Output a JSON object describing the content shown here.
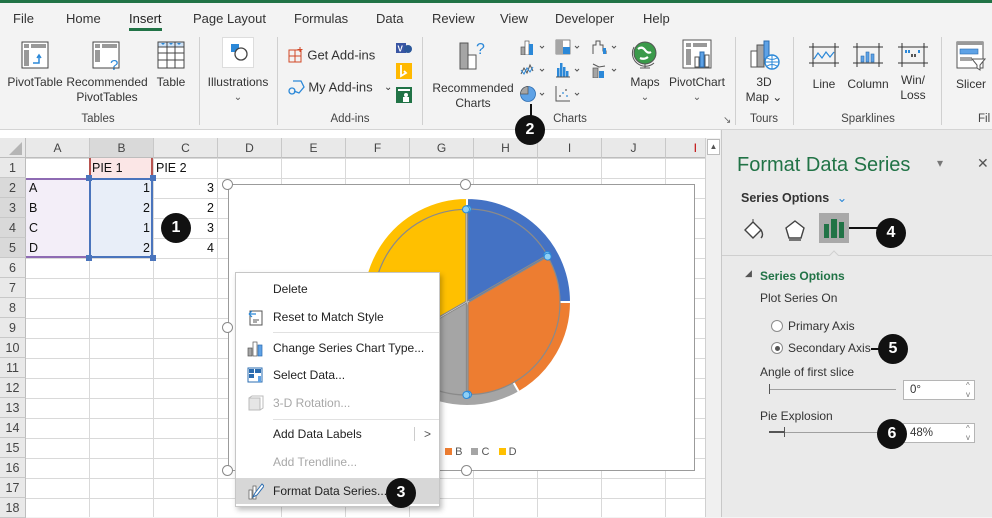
{
  "ribbon_tabs": [
    "File",
    "Home",
    "Insert",
    "Page Layout",
    "Formulas",
    "Data",
    "Review",
    "View",
    "Developer",
    "Help"
  ],
  "active_tab": "Insert",
  "ribbon": {
    "tables": {
      "label": "Tables",
      "pivottable": "PivotTable",
      "recommended_pivot_1": "Recommended",
      "recommended_pivot_2": "PivotTables",
      "table": "Table"
    },
    "illustrations": {
      "label": "Illustrations",
      "chevron": "⌄"
    },
    "addins": {
      "label": "Add-ins",
      "get": "Get Add-ins",
      "my": "My Add-ins",
      "chevron": "⌄"
    },
    "charts": {
      "label": "Charts",
      "recommended_1": "Recommended",
      "recommended_2": "Charts",
      "maps": "Maps",
      "pivotchart": "PivotChart",
      "chevron": "⌄",
      "launcher": "↘"
    },
    "tours": {
      "label": "Tours",
      "map_1": "3D",
      "map_2": "Map ⌄"
    },
    "sparklines": {
      "label": "Sparklines",
      "line": "Line",
      "column": "Column",
      "winloss_1": "Win/",
      "winloss_2": "Loss"
    },
    "filters": {
      "label": "Fil",
      "slicer": "Slicer"
    }
  },
  "sheet": {
    "columns": [
      "A",
      "B",
      "C",
      "D",
      "E",
      "F",
      "G",
      "H",
      "I",
      "J",
      "I"
    ],
    "rows": [
      "1",
      "2",
      "3",
      "4",
      "5",
      "6",
      "7",
      "8",
      "9",
      "10",
      "11",
      "12",
      "13",
      "14",
      "15",
      "16",
      "17",
      "18"
    ],
    "header": {
      "b1": "PIE 1",
      "c1": "PIE 2"
    },
    "data": [
      {
        "label": "A",
        "pie1": "1",
        "pie2": "3"
      },
      {
        "label": "B",
        "pie1": "2",
        "pie2": "2"
      },
      {
        "label": "C",
        "pie1": "1",
        "pie2": "3"
      },
      {
        "label": "D",
        "pie1": "2",
        "pie2": "4"
      }
    ]
  },
  "chart": {
    "type": "pie",
    "legend": [
      "A",
      "B",
      "C",
      "D"
    ],
    "colors": {
      "A": "#4472c4",
      "B": "#ed7d31",
      "C": "#a5a5a5",
      "D": "#ffc000"
    }
  },
  "context_menu": {
    "items": [
      {
        "label": "Delete",
        "icon": "none",
        "disabled": false
      },
      {
        "label": "Reset to Match Style",
        "icon": "reset-style-icon",
        "disabled": false
      },
      {
        "label": "Change Series Chart Type...",
        "icon": "chart-type-icon",
        "disabled": false
      },
      {
        "label": "Select Data...",
        "icon": "select-data-icon",
        "disabled": false
      },
      {
        "label": "3-D Rotation...",
        "icon": "3d-rotation-icon",
        "disabled": true
      },
      {
        "label": "Add Data Labels",
        "icon": "none",
        "disabled": false,
        "submenu": ">"
      },
      {
        "label": "Add Trendline...",
        "icon": "none",
        "disabled": true
      },
      {
        "label": "Format Data Series...",
        "icon": "format-series-icon",
        "disabled": false
      }
    ]
  },
  "format_pane": {
    "title": "Format Data Series",
    "dropdown": "▾",
    "close": "✕",
    "series_options_label": "Series Options",
    "section_title": "Series Options",
    "plot_series_on": "Plot Series On",
    "primary_axis": "Primary Axis",
    "secondary_axis": "Secondary Axis",
    "selected_axis": "Secondary Axis",
    "angle_label": "Angle of first slice",
    "angle_value": "0°",
    "explosion_label": "Pie Explosion",
    "explosion_value": "48%",
    "explosion_fraction": 0.048
  },
  "badges": [
    "1",
    "2",
    "3",
    "4",
    "5",
    "6"
  ],
  "accent_color": "#217346"
}
